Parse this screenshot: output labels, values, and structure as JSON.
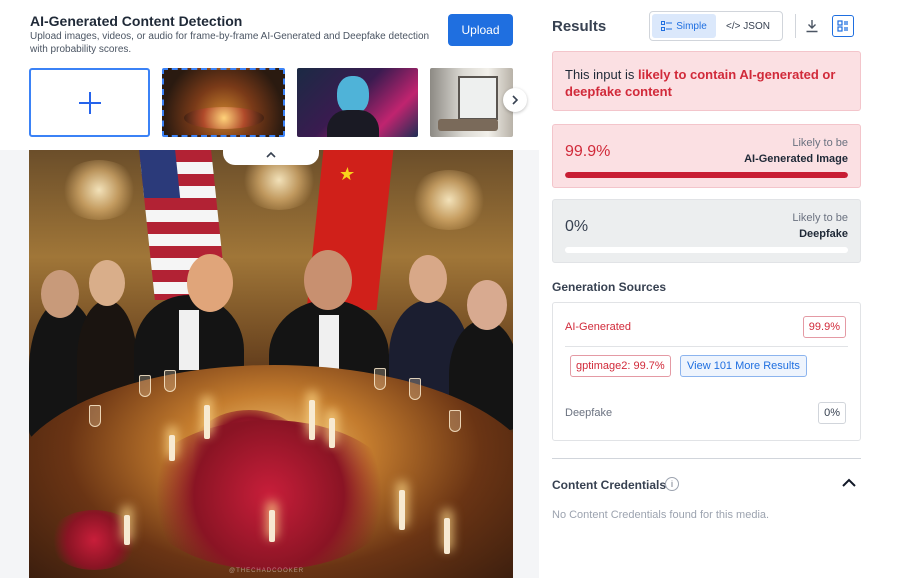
{
  "header": {
    "title": "AI-Generated Content Detection",
    "subtitle": "Upload images, videos, or audio for frame-by-frame AI-Generated and Deepfake detection with probability scores.",
    "upload_label": "Upload"
  },
  "thumbnails": [
    {
      "name": "banquet-thumbnail",
      "selected": true
    },
    {
      "name": "cyberpunk-portrait-thumbnail",
      "selected": false
    },
    {
      "name": "interior-room-thumbnail",
      "selected": false
    }
  ],
  "image": {
    "watermark": "@THECHADCOOKER"
  },
  "results": {
    "title": "Results",
    "view_simple": "Simple",
    "view_json": "</> JSON",
    "active_view": "Simple"
  },
  "verdict": {
    "prefix": "This input is ",
    "highlight": "likely to contain AI-generated or deepfake content"
  },
  "scores": {
    "ai": {
      "value": "99.9%",
      "label_top": "Likely to be",
      "label_bottom": "AI-Generated Image",
      "fraction": 0.999
    },
    "deepfake": {
      "value": "0%",
      "label_top": "Likely to be",
      "label_bottom": "Deepfake",
      "fraction": 0
    }
  },
  "generation": {
    "title": "Generation Sources",
    "ai_label": "AI-Generated",
    "ai_value": "99.9%",
    "model": "gptimage2: 99.7%",
    "more_label": "View 101 More Results",
    "deepfake_label": "Deepfake",
    "deepfake_value": "0%"
  },
  "credentials": {
    "title": "Content Credentials",
    "text": "No Content Credentials found for this media."
  },
  "colors": {
    "accent": "#1f6fe0",
    "danger": "#d12a3a",
    "danger_bg": "#fbe0e3"
  }
}
